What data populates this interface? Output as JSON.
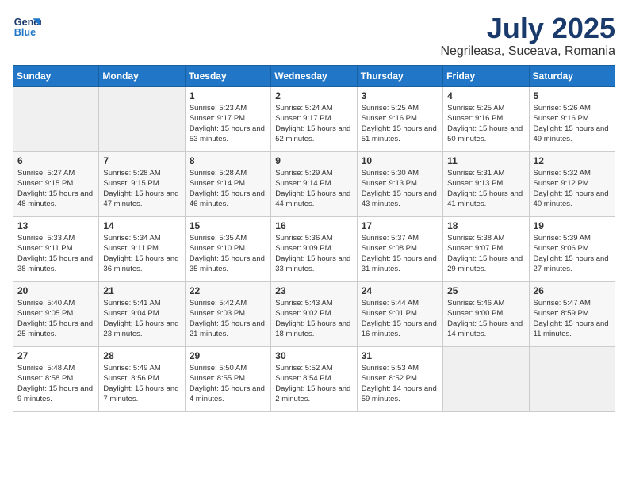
{
  "header": {
    "logo_line1": "General",
    "logo_line2": "Blue",
    "month": "July 2025",
    "location": "Negrileasa, Suceava, Romania"
  },
  "weekdays": [
    "Sunday",
    "Monday",
    "Tuesday",
    "Wednesday",
    "Thursday",
    "Friday",
    "Saturday"
  ],
  "weeks": [
    [
      {
        "day": "",
        "info": ""
      },
      {
        "day": "",
        "info": ""
      },
      {
        "day": "1",
        "info": "Sunrise: 5:23 AM\nSunset: 9:17 PM\nDaylight: 15 hours and 53 minutes."
      },
      {
        "day": "2",
        "info": "Sunrise: 5:24 AM\nSunset: 9:17 PM\nDaylight: 15 hours and 52 minutes."
      },
      {
        "day": "3",
        "info": "Sunrise: 5:25 AM\nSunset: 9:16 PM\nDaylight: 15 hours and 51 minutes."
      },
      {
        "day": "4",
        "info": "Sunrise: 5:25 AM\nSunset: 9:16 PM\nDaylight: 15 hours and 50 minutes."
      },
      {
        "day": "5",
        "info": "Sunrise: 5:26 AM\nSunset: 9:16 PM\nDaylight: 15 hours and 49 minutes."
      }
    ],
    [
      {
        "day": "6",
        "info": "Sunrise: 5:27 AM\nSunset: 9:15 PM\nDaylight: 15 hours and 48 minutes."
      },
      {
        "day": "7",
        "info": "Sunrise: 5:28 AM\nSunset: 9:15 PM\nDaylight: 15 hours and 47 minutes."
      },
      {
        "day": "8",
        "info": "Sunrise: 5:28 AM\nSunset: 9:14 PM\nDaylight: 15 hours and 46 minutes."
      },
      {
        "day": "9",
        "info": "Sunrise: 5:29 AM\nSunset: 9:14 PM\nDaylight: 15 hours and 44 minutes."
      },
      {
        "day": "10",
        "info": "Sunrise: 5:30 AM\nSunset: 9:13 PM\nDaylight: 15 hours and 43 minutes."
      },
      {
        "day": "11",
        "info": "Sunrise: 5:31 AM\nSunset: 9:13 PM\nDaylight: 15 hours and 41 minutes."
      },
      {
        "day": "12",
        "info": "Sunrise: 5:32 AM\nSunset: 9:12 PM\nDaylight: 15 hours and 40 minutes."
      }
    ],
    [
      {
        "day": "13",
        "info": "Sunrise: 5:33 AM\nSunset: 9:11 PM\nDaylight: 15 hours and 38 minutes."
      },
      {
        "day": "14",
        "info": "Sunrise: 5:34 AM\nSunset: 9:11 PM\nDaylight: 15 hours and 36 minutes."
      },
      {
        "day": "15",
        "info": "Sunrise: 5:35 AM\nSunset: 9:10 PM\nDaylight: 15 hours and 35 minutes."
      },
      {
        "day": "16",
        "info": "Sunrise: 5:36 AM\nSunset: 9:09 PM\nDaylight: 15 hours and 33 minutes."
      },
      {
        "day": "17",
        "info": "Sunrise: 5:37 AM\nSunset: 9:08 PM\nDaylight: 15 hours and 31 minutes."
      },
      {
        "day": "18",
        "info": "Sunrise: 5:38 AM\nSunset: 9:07 PM\nDaylight: 15 hours and 29 minutes."
      },
      {
        "day": "19",
        "info": "Sunrise: 5:39 AM\nSunset: 9:06 PM\nDaylight: 15 hours and 27 minutes."
      }
    ],
    [
      {
        "day": "20",
        "info": "Sunrise: 5:40 AM\nSunset: 9:05 PM\nDaylight: 15 hours and 25 minutes."
      },
      {
        "day": "21",
        "info": "Sunrise: 5:41 AM\nSunset: 9:04 PM\nDaylight: 15 hours and 23 minutes."
      },
      {
        "day": "22",
        "info": "Sunrise: 5:42 AM\nSunset: 9:03 PM\nDaylight: 15 hours and 21 minutes."
      },
      {
        "day": "23",
        "info": "Sunrise: 5:43 AM\nSunset: 9:02 PM\nDaylight: 15 hours and 18 minutes."
      },
      {
        "day": "24",
        "info": "Sunrise: 5:44 AM\nSunset: 9:01 PM\nDaylight: 15 hours and 16 minutes."
      },
      {
        "day": "25",
        "info": "Sunrise: 5:46 AM\nSunset: 9:00 PM\nDaylight: 15 hours and 14 minutes."
      },
      {
        "day": "26",
        "info": "Sunrise: 5:47 AM\nSunset: 8:59 PM\nDaylight: 15 hours and 11 minutes."
      }
    ],
    [
      {
        "day": "27",
        "info": "Sunrise: 5:48 AM\nSunset: 8:58 PM\nDaylight: 15 hours and 9 minutes."
      },
      {
        "day": "28",
        "info": "Sunrise: 5:49 AM\nSunset: 8:56 PM\nDaylight: 15 hours and 7 minutes."
      },
      {
        "day": "29",
        "info": "Sunrise: 5:50 AM\nSunset: 8:55 PM\nDaylight: 15 hours and 4 minutes."
      },
      {
        "day": "30",
        "info": "Sunrise: 5:52 AM\nSunset: 8:54 PM\nDaylight: 15 hours and 2 minutes."
      },
      {
        "day": "31",
        "info": "Sunrise: 5:53 AM\nSunset: 8:52 PM\nDaylight: 14 hours and 59 minutes."
      },
      {
        "day": "",
        "info": ""
      },
      {
        "day": "",
        "info": ""
      }
    ]
  ]
}
